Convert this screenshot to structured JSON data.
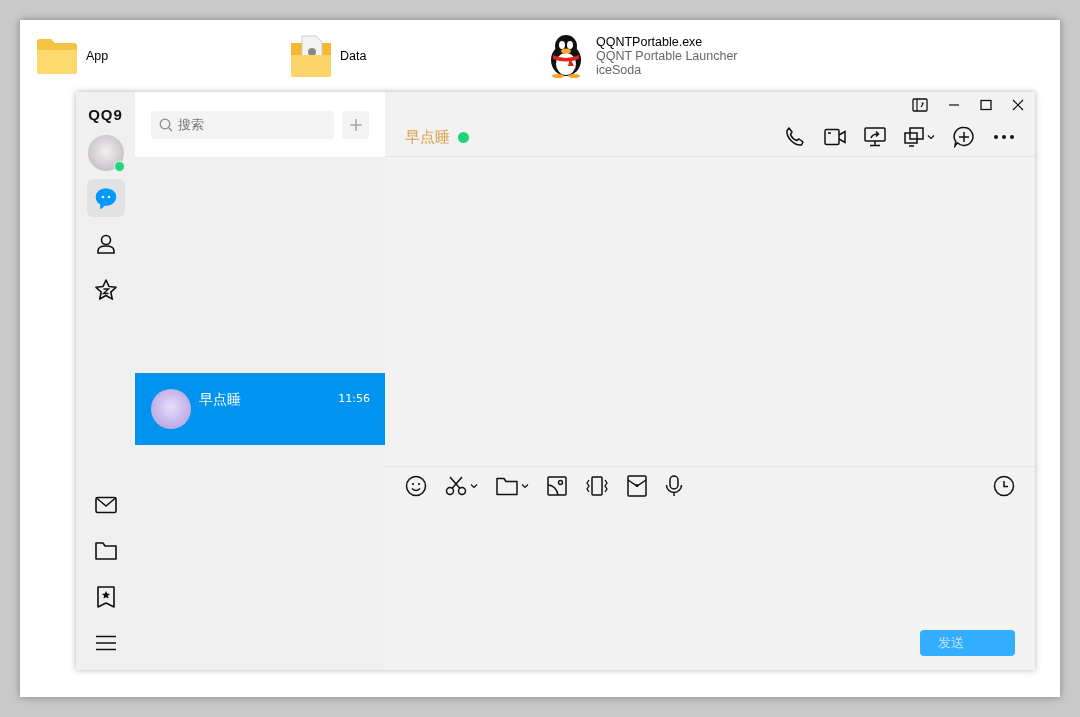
{
  "desktop": {
    "items": [
      {
        "kind": "folder",
        "name": "App"
      },
      {
        "kind": "folder_doc",
        "name": "Data"
      },
      {
        "kind": "app",
        "name": "QQNTPortable.exe",
        "description": "QQNT Portable Launcher",
        "publisher": "iceSoda"
      }
    ]
  },
  "sidebar": {
    "logo": "QQ9",
    "online": true,
    "items": [
      {
        "selected": true
      },
      {
        "selected": false
      },
      {
        "selected": false
      }
    ]
  },
  "search": {
    "placeholder": "搜索"
  },
  "conversations": [
    {
      "name": "早点睡",
      "time": "11:56",
      "selected": true
    }
  ],
  "chat": {
    "title": "早点睡",
    "online": true
  },
  "send_button": {
    "label": "发送",
    "disabled": true
  }
}
